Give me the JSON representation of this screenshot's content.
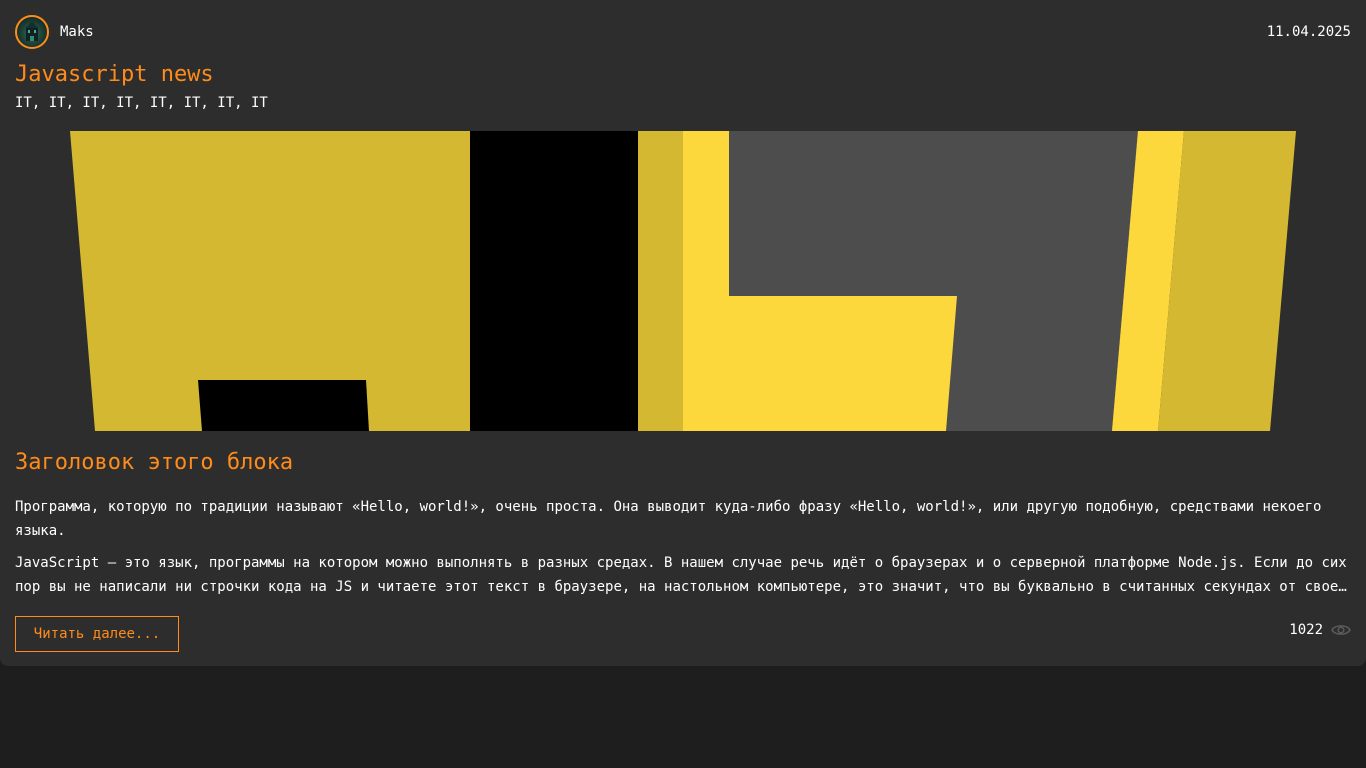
{
  "post": {
    "author": "Maks",
    "date": "11.04.2025",
    "title": "Javascript news",
    "tags": "IT, IT, IT, IT, IT, IT, IT, IT",
    "block_title": "Заголовок этого блока",
    "paragraph_1": "Программа, которую по традиции называют «Hello, world!», очень проста. Она выводит куда-либо фразу «Hello, world!», или другую подобную, средствами некоего языка.",
    "paragraph_2": "JavaScript — это язык, программы на котором можно выполнять в разных средах. В нашем случае речь идёт о браузерах и о серверной платформе Node.js. Если до сих пор вы не написали ни строчки кода на JS и читаете этот текст в браузере, на настольном компьютере, это значит, что вы буквально в считанных секундах от своей первой JavaScript-программы.",
    "read_more_label": "Читать далее...",
    "views": "1022"
  },
  "icons": {
    "avatar": "avatar-image",
    "views": "eye-icon"
  },
  "colors": {
    "accent": "#ff8c1a",
    "card_background": "#2d2d2d",
    "page_background": "#1e1e1e",
    "banner_yellow": "#d4b832",
    "banner_yellow_light": "#fdd83d",
    "banner_gray": "#4d4d4d"
  }
}
